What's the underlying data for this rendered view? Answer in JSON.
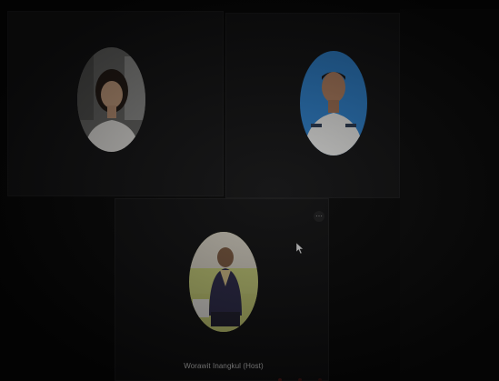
{
  "participants": [
    {
      "name": "",
      "avatar_icon": "participant-woman-avatar-icon",
      "bg_color": "#6b6b6b"
    },
    {
      "name": "",
      "avatar_icon": "participant-officer-avatar-icon",
      "bg_color": "#2f86d8"
    },
    {
      "name": "Worawit Inangkul (Host)",
      "avatar_icon": "participant-graduate-avatar-icon",
      "bg_color": "#c8cf77"
    }
  ],
  "controls": {
    "more_icon": "more-options-icon",
    "more_glyph": "⋯"
  },
  "colors": {
    "background": "#070707",
    "tile": "#121213",
    "label": "#d9d9d9"
  }
}
